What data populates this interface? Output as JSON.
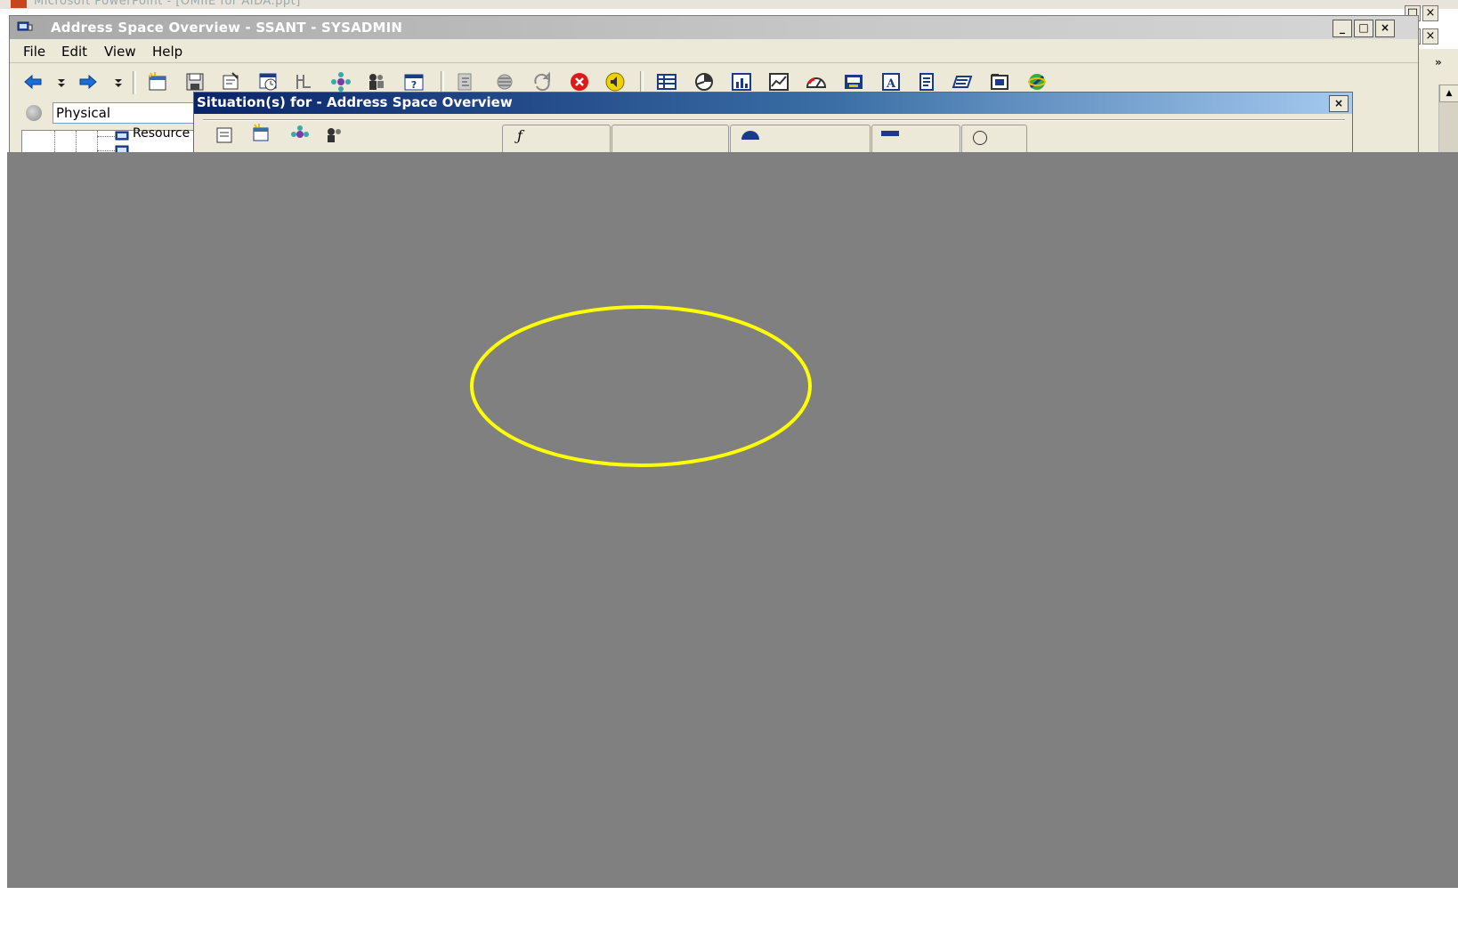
{
  "background_app": {
    "title": "Microsoft PowerPoint - [OMIIE for AIDA.ppt]",
    "controls": {
      "restore": "□",
      "close": "×"
    },
    "right_toolbar_chevron": "»",
    "scroll_up": "▲"
  },
  "window": {
    "title": "Address Space Overview - SSANT - SYSADMIN",
    "controls": {
      "minimize": "_",
      "maximize": "□",
      "close": "×"
    },
    "menu": [
      "File",
      "Edit",
      "View",
      "Help"
    ],
    "toolbar": [
      {
        "name": "back-arrow-icon",
        "color": "#1a6fd6"
      },
      {
        "name": "back-dropdown-icon"
      },
      {
        "name": "forward-arrow-icon",
        "color": "#1a6fd6"
      },
      {
        "name": "forward-dropdown-icon"
      },
      {
        "name": "new-workspace-icon"
      },
      {
        "name": "save-icon"
      },
      {
        "name": "properties-icon"
      },
      {
        "name": "timespan-icon"
      },
      {
        "name": "link-icon"
      },
      {
        "name": "topology-icon"
      },
      {
        "name": "users-icon"
      },
      {
        "name": "help-icon"
      },
      {
        "name": "situation-editor-icon"
      },
      {
        "name": "event-console-icon"
      },
      {
        "name": "refresh-icon"
      },
      {
        "name": "stop-icon",
        "color": "#e01818"
      },
      {
        "name": "sound-icon",
        "color": "#e0a000"
      },
      {
        "name": "table-view-icon"
      },
      {
        "name": "pie-chart-icon"
      },
      {
        "name": "bar-chart-icon"
      },
      {
        "name": "plot-chart-icon"
      },
      {
        "name": "gauge-icon"
      },
      {
        "name": "notepad-icon"
      },
      {
        "name": "event-view-icon"
      },
      {
        "name": "take-action-icon"
      },
      {
        "name": "message-log-icon"
      },
      {
        "name": "terminal-view-icon"
      },
      {
        "name": "browser-icon"
      }
    ]
  },
  "left_pane": {
    "view_selector": "Physical",
    "tree_item": "Resource"
  },
  "dialog": {
    "title": "Situation(s) for - Address Space Overview",
    "close": "×"
  },
  "overlay": {
    "color": "#808080",
    "highlight_color": "#ffff00"
  }
}
